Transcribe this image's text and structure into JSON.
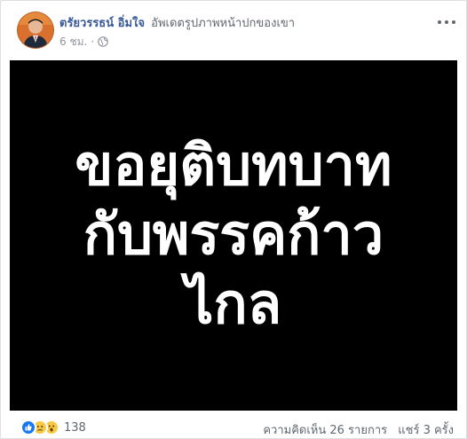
{
  "post": {
    "author_name": "ตรัยวรรธน์ อิ่มใจ",
    "action_text": "อัพเดตรูปภาพหน้าปกของเขา",
    "timestamp": "6 ชม.",
    "separator": "·",
    "privacy_icon": "globe-icon",
    "menu_icon": "more-options-icon"
  },
  "image": {
    "background_color": "#000000",
    "text_color": "#ffffff",
    "lines": [
      "ขอยุติบทบาท",
      "กับพรรคก้าว",
      "ไกล"
    ]
  },
  "footer": {
    "reaction_icons": [
      "like-icon",
      "sad-icon",
      "wow-icon"
    ],
    "reaction_count": "138",
    "comments": "ความคิดเห็น 26 รายการ",
    "shares": "แชร์ 3 ครั้ง"
  },
  "colors": {
    "link_blue": "#385898",
    "secondary_gray": "#90949c",
    "like_blue": "#1877f2",
    "emoji_yellow": "#f7c843"
  }
}
